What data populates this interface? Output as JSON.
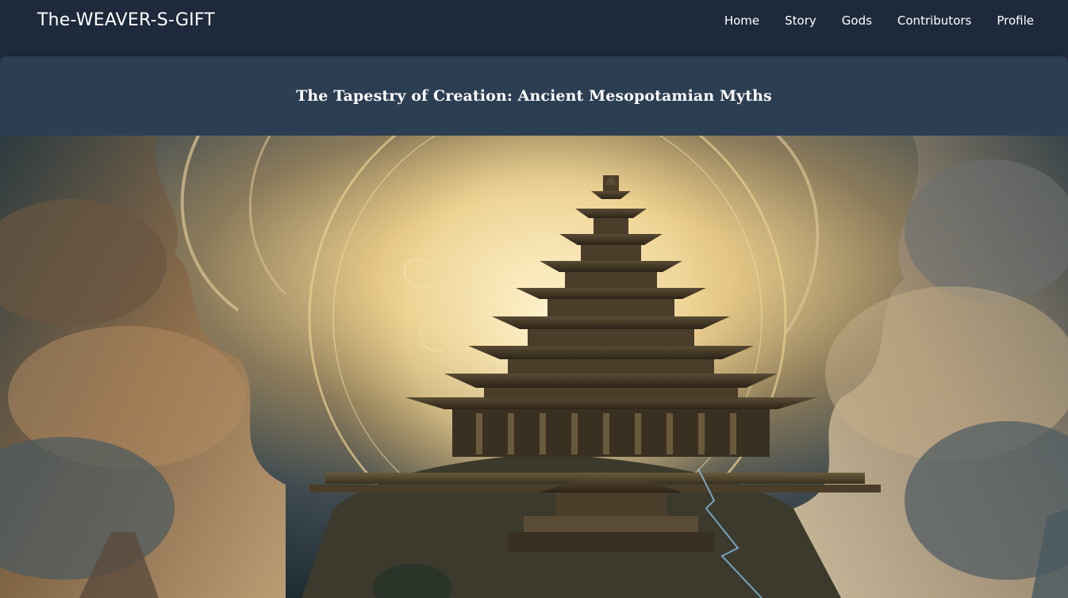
{
  "navbar": {
    "brand": "The-WEAVER-S-GIFT",
    "links": [
      {
        "label": "Home"
      },
      {
        "label": "Story"
      },
      {
        "label": "Gods"
      },
      {
        "label": "Contributors"
      },
      {
        "label": "Profile"
      }
    ]
  },
  "header": {
    "title": "The Tapestry of Creation: Ancient Mesopotamian Myths"
  },
  "colors": {
    "navbar_bg": "#1e293b",
    "title_card_bg": "#2c3e52",
    "text": "#ffffff"
  }
}
